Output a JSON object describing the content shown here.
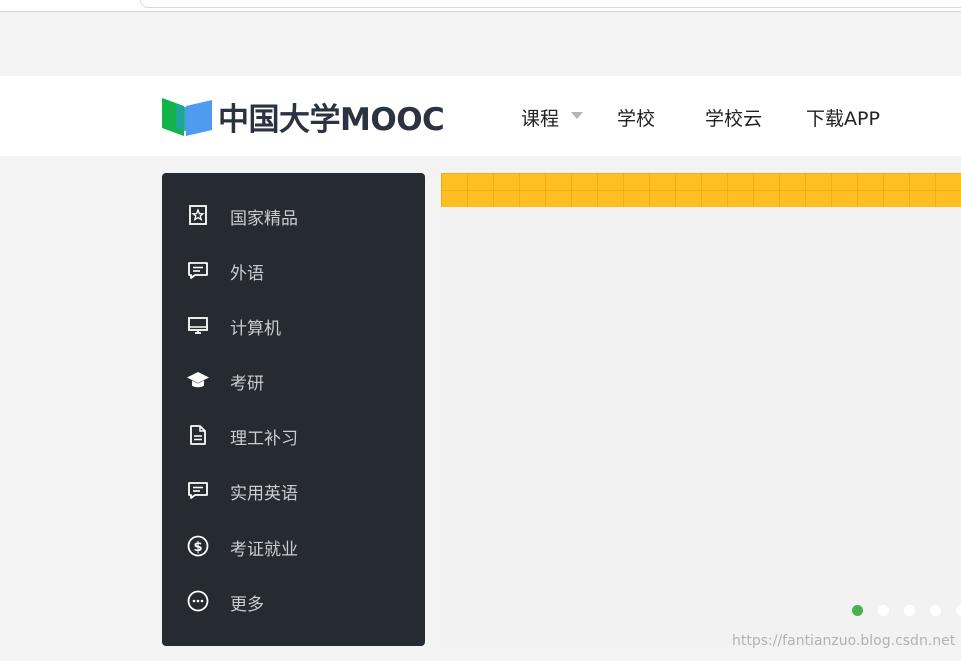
{
  "header": {
    "logo_text": "中国大学MOOC",
    "nav": [
      {
        "label": "课程",
        "has_dropdown": true
      },
      {
        "label": "学校"
      },
      {
        "label": "学校云"
      },
      {
        "label": "下载APP"
      }
    ]
  },
  "sidebar": {
    "items": [
      {
        "label": "国家精品",
        "icon": "star-badge-icon"
      },
      {
        "label": "外语",
        "icon": "chat-bubble-icon"
      },
      {
        "label": "计算机",
        "icon": "monitor-icon"
      },
      {
        "label": "考研",
        "icon": "graduation-cap-icon"
      },
      {
        "label": "理工补习",
        "icon": "document-icon"
      },
      {
        "label": "实用英语",
        "icon": "chat-bubble-icon"
      },
      {
        "label": "考证就业",
        "icon": "dollar-circle-icon"
      },
      {
        "label": "更多",
        "icon": "more-circle-icon"
      }
    ]
  },
  "carousel": {
    "slides": 5,
    "active_index": 0
  },
  "watermark": "https://fantianzuo.blog.csdn.net",
  "colors": {
    "brand_green": "#44b549",
    "logo_blue": "#3a8ee6",
    "sidebar_bg": "#262a31",
    "banner_yellow": "#ffbe22"
  }
}
